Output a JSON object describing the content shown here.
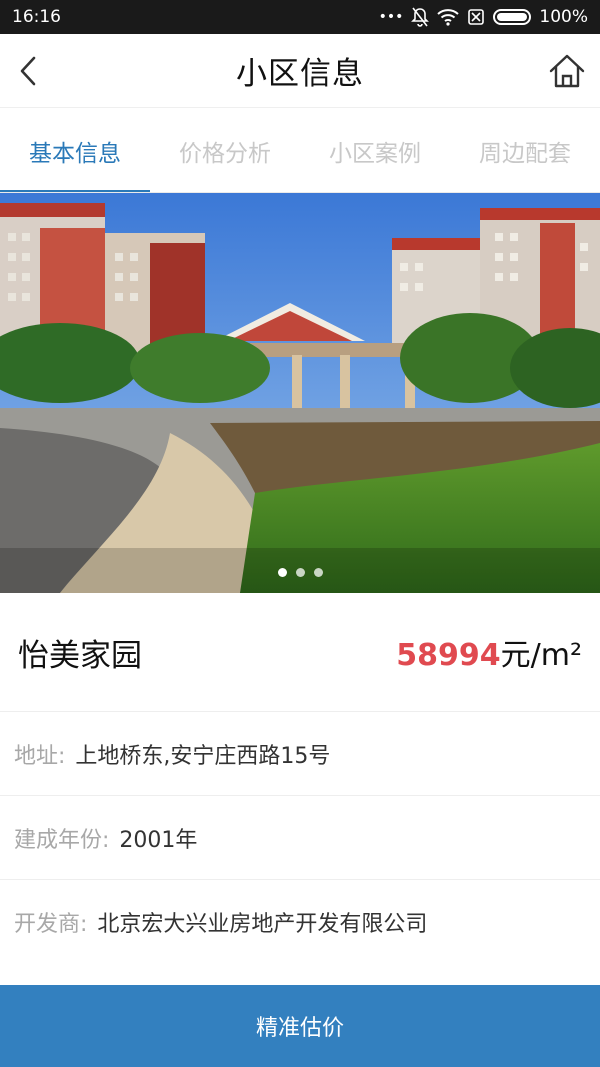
{
  "status_bar": {
    "time": "16:16",
    "dots": "•••",
    "battery_percent": "100%"
  },
  "header": {
    "title": "小区信息",
    "back_icon": "chevron-left-icon",
    "home_icon": "home-icon"
  },
  "tabs": [
    {
      "label": "基本信息",
      "active": true
    },
    {
      "label": "价格分析",
      "active": false
    },
    {
      "label": "小区案例",
      "active": false
    },
    {
      "label": "周边配套",
      "active": false
    }
  ],
  "carousel": {
    "slide_count": 3,
    "active_index": 0
  },
  "community": {
    "name": "怡美家园",
    "price_value": "58994",
    "price_unit": "元/m²"
  },
  "details": [
    {
      "label": "地址:",
      "value": "上地桥东,安宁庄西路15号"
    },
    {
      "label": "建成年份:",
      "value": "2001年"
    },
    {
      "label": "开发商:",
      "value": "北京宏大兴业房地产开发有限公司"
    }
  ],
  "bottom_button": {
    "label": "精准估价"
  },
  "colors": {
    "accent": "#2a79b8",
    "price": "#e04a50",
    "button": "#3380bf"
  }
}
